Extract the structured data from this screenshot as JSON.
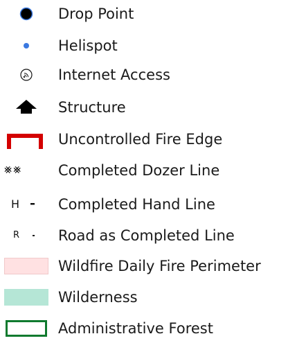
{
  "legend": {
    "items": [
      {
        "id": "drop-point",
        "label": "Drop Point",
        "symbol": "filled-black-circle-blue-ring"
      },
      {
        "id": "helispot",
        "label": "Helispot",
        "symbol": "small-blue-dot"
      },
      {
        "id": "internet-access",
        "label": "Internet Access",
        "symbol": "wifi-circle-icon"
      },
      {
        "id": "structure",
        "label": "Structure",
        "symbol": "house-arrow-icon"
      },
      {
        "id": "uncontrolled-fire-edge",
        "label": "Uncontrolled Fire Edge",
        "symbol": "red-bracket-line"
      },
      {
        "id": "completed-dozer-line",
        "label": "Completed Dozer Line",
        "symbol": "crosshatch-line",
        "glyph": "⨳⨳"
      },
      {
        "id": "completed-hand-line",
        "label": "Completed Hand Line",
        "symbol": "h-dash",
        "glyph": "H"
      },
      {
        "id": "road-as-completed-line",
        "label": "Road as Completed Line",
        "symbol": "r-dash",
        "glyph": "R"
      },
      {
        "id": "wildfire-daily-fire-perimeter",
        "label": "Wildfire Daily Fire Perimeter",
        "symbol": "pink-fill"
      },
      {
        "id": "wilderness",
        "label": "Wilderness",
        "symbol": "teal-fill"
      },
      {
        "id": "administrative-forest",
        "label": "Administrative Forest",
        "symbol": "green-outline"
      }
    ]
  },
  "colors": {
    "fire_edge": "#d40000",
    "helispot": "#3a78e0",
    "perimeter_fill": "#ffe1e2",
    "wilderness_fill": "#b5e6d6",
    "admin_forest_outline": "#0f7a2e"
  }
}
